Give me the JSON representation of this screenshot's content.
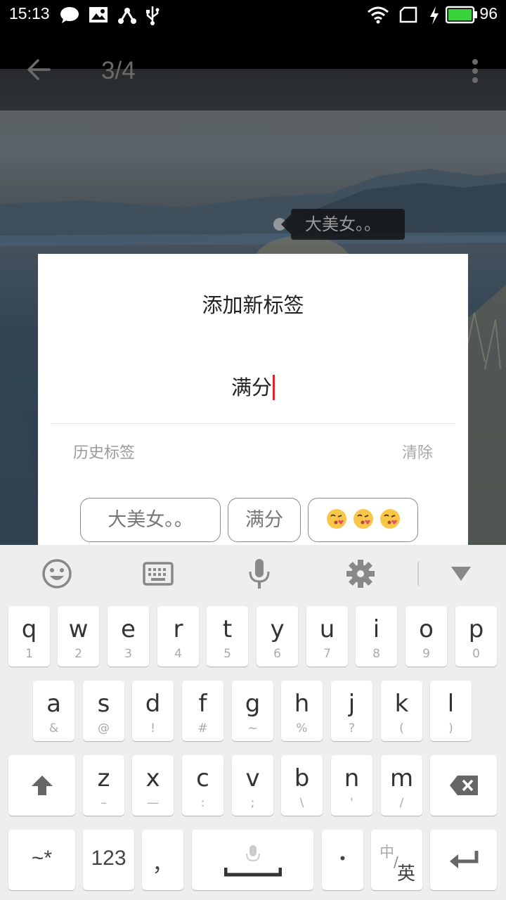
{
  "status_bar": {
    "time": "15:13",
    "battery_level": "96",
    "icons": [
      "chat-icon",
      "image-icon",
      "share-icon",
      "usb-icon",
      "wifi-icon",
      "sim-icon",
      "charging-icon",
      "battery-icon"
    ]
  },
  "toolbar": {
    "page_counter": "3/4",
    "icons": [
      "back-arrow-icon",
      "more-vertical-icon"
    ]
  },
  "photo_tag": {
    "text": "大美女。。"
  },
  "dialog": {
    "title": "添加新标签",
    "input_value": "满分",
    "history_label": "历史标签",
    "clear_label": "清除",
    "history_tags": [
      "大美女。。",
      "满分"
    ],
    "emoji_tag_icon": "kissing-face-icon"
  },
  "keyboard": {
    "toolbar_icons": [
      "emoji-icon",
      "keyboard-icon",
      "microphone-icon",
      "settings-icon",
      "collapse-icon"
    ],
    "row1": [
      {
        "main": "q",
        "sub": "1"
      },
      {
        "main": "w",
        "sub": "2"
      },
      {
        "main": "e",
        "sub": "3"
      },
      {
        "main": "r",
        "sub": "4"
      },
      {
        "main": "t",
        "sub": "5"
      },
      {
        "main": "y",
        "sub": "6"
      },
      {
        "main": "u",
        "sub": "7"
      },
      {
        "main": "i",
        "sub": "8"
      },
      {
        "main": "o",
        "sub": "9"
      },
      {
        "main": "p",
        "sub": "0"
      }
    ],
    "row2": [
      {
        "main": "a",
        "sub": "&"
      },
      {
        "main": "s",
        "sub": "@"
      },
      {
        "main": "d",
        "sub": "!"
      },
      {
        "main": "f",
        "sub": "#"
      },
      {
        "main": "g",
        "sub": "~"
      },
      {
        "main": "h",
        "sub": "%"
      },
      {
        "main": "j",
        "sub": "?"
      },
      {
        "main": "k",
        "sub": "("
      },
      {
        "main": "l",
        "sub": ")"
      }
    ],
    "row3": [
      {
        "main": "z",
        "sub": "–"
      },
      {
        "main": "x",
        "sub": "—"
      },
      {
        "main": "c",
        "sub": ":"
      },
      {
        "main": "v",
        "sub": ";"
      },
      {
        "main": "b",
        "sub": "\\"
      },
      {
        "main": "n",
        "sub": "'"
      },
      {
        "main": "m",
        "sub": "/"
      }
    ],
    "symbols_key": "~*",
    "numbers_key": "123",
    "comma_key": "，",
    "period_key": "•",
    "lang_key_top": "中",
    "lang_key_sep": "/",
    "lang_key_bottom": "英"
  },
  "colors": {
    "accent_caret": "#d42b2b",
    "battery": "#3ad23a"
  }
}
